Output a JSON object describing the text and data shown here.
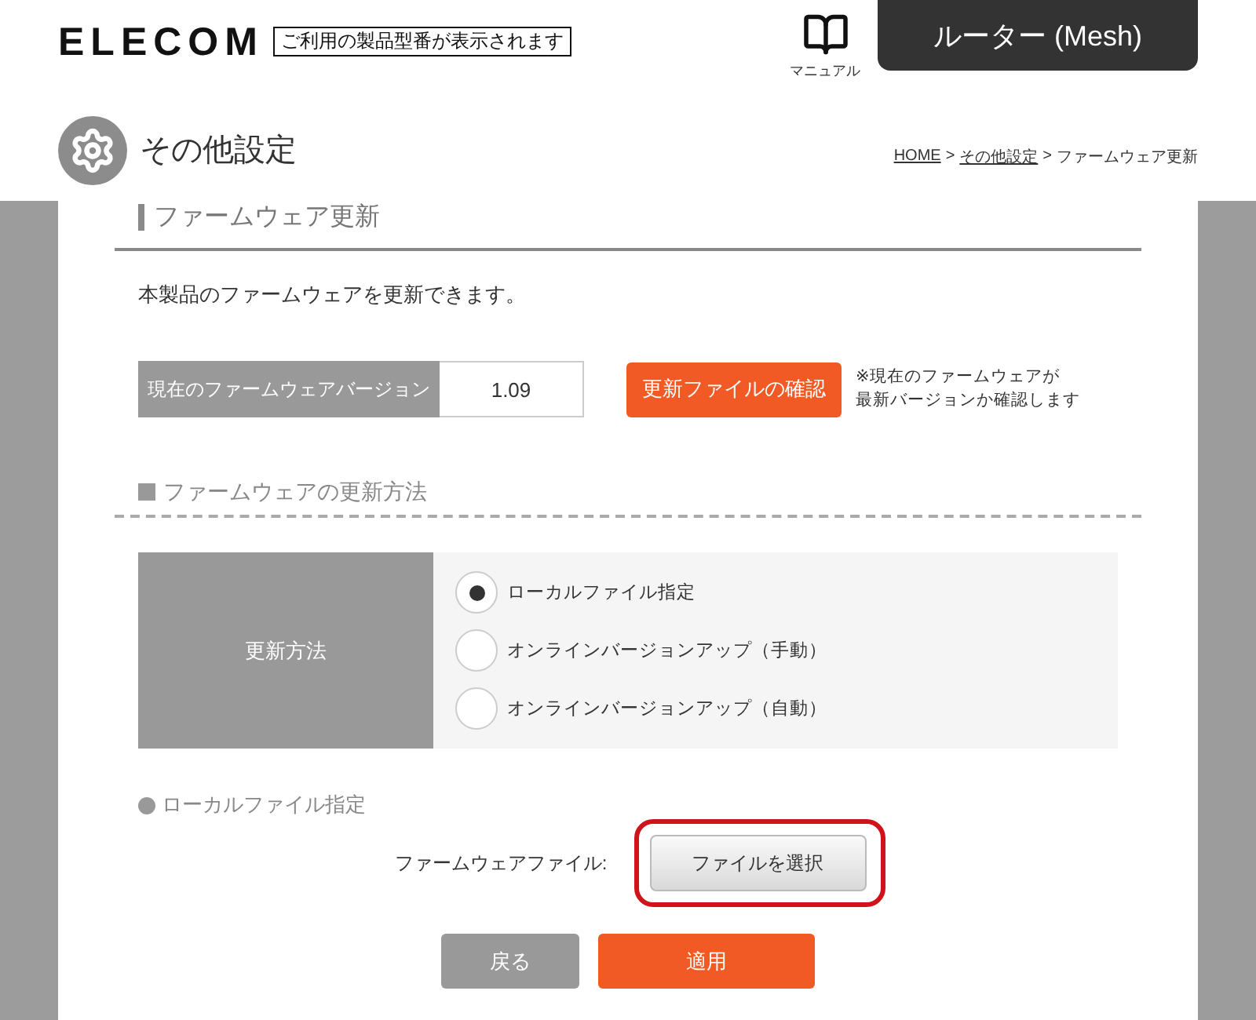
{
  "header": {
    "logo": "ELECOM",
    "model_label": "ご利用の製品型番が表示されます",
    "manual_label": "マニュアル",
    "mode_banner": "ルーター (Mesh)"
  },
  "page": {
    "title": "その他設定",
    "breadcrumb": [
      {
        "kind": "link",
        "label": "HOME"
      },
      {
        "kind": "separator",
        "label": ">"
      },
      {
        "kind": "link",
        "label": "その他設定"
      },
      {
        "kind": "separator",
        "label": ">"
      },
      {
        "kind": "current",
        "label": "ファームウェア更新"
      }
    ]
  },
  "firmware_section": {
    "heading": "ファームウェア更新",
    "description": "本製品のファームウェアを更新できます。",
    "version_label": "現在のファームウェアバージョン",
    "version_value": "1.09",
    "check_button": "更新ファイルの確認",
    "check_note_lines": [
      "※現在のファームウェアが",
      "最新バージョンか確認します"
    ]
  },
  "method_section": {
    "heading": "ファームウェアの更新方法",
    "row_label": "更新方法",
    "options": [
      {
        "label": "ローカルファイル指定",
        "selected": true
      },
      {
        "label": "オンラインバージョンアップ（手動）",
        "selected": false
      },
      {
        "label": "オンラインバージョンアップ（自動）",
        "selected": false
      }
    ]
  },
  "local_section": {
    "heading": "ローカルファイル指定",
    "file_label": "ファームウェアファイル:",
    "file_button": "ファイルを選択",
    "highlighted": true
  },
  "actions": [
    {
      "kind": "secondary",
      "label": "戻る"
    },
    {
      "kind": "primary",
      "label": "適用"
    }
  ]
}
